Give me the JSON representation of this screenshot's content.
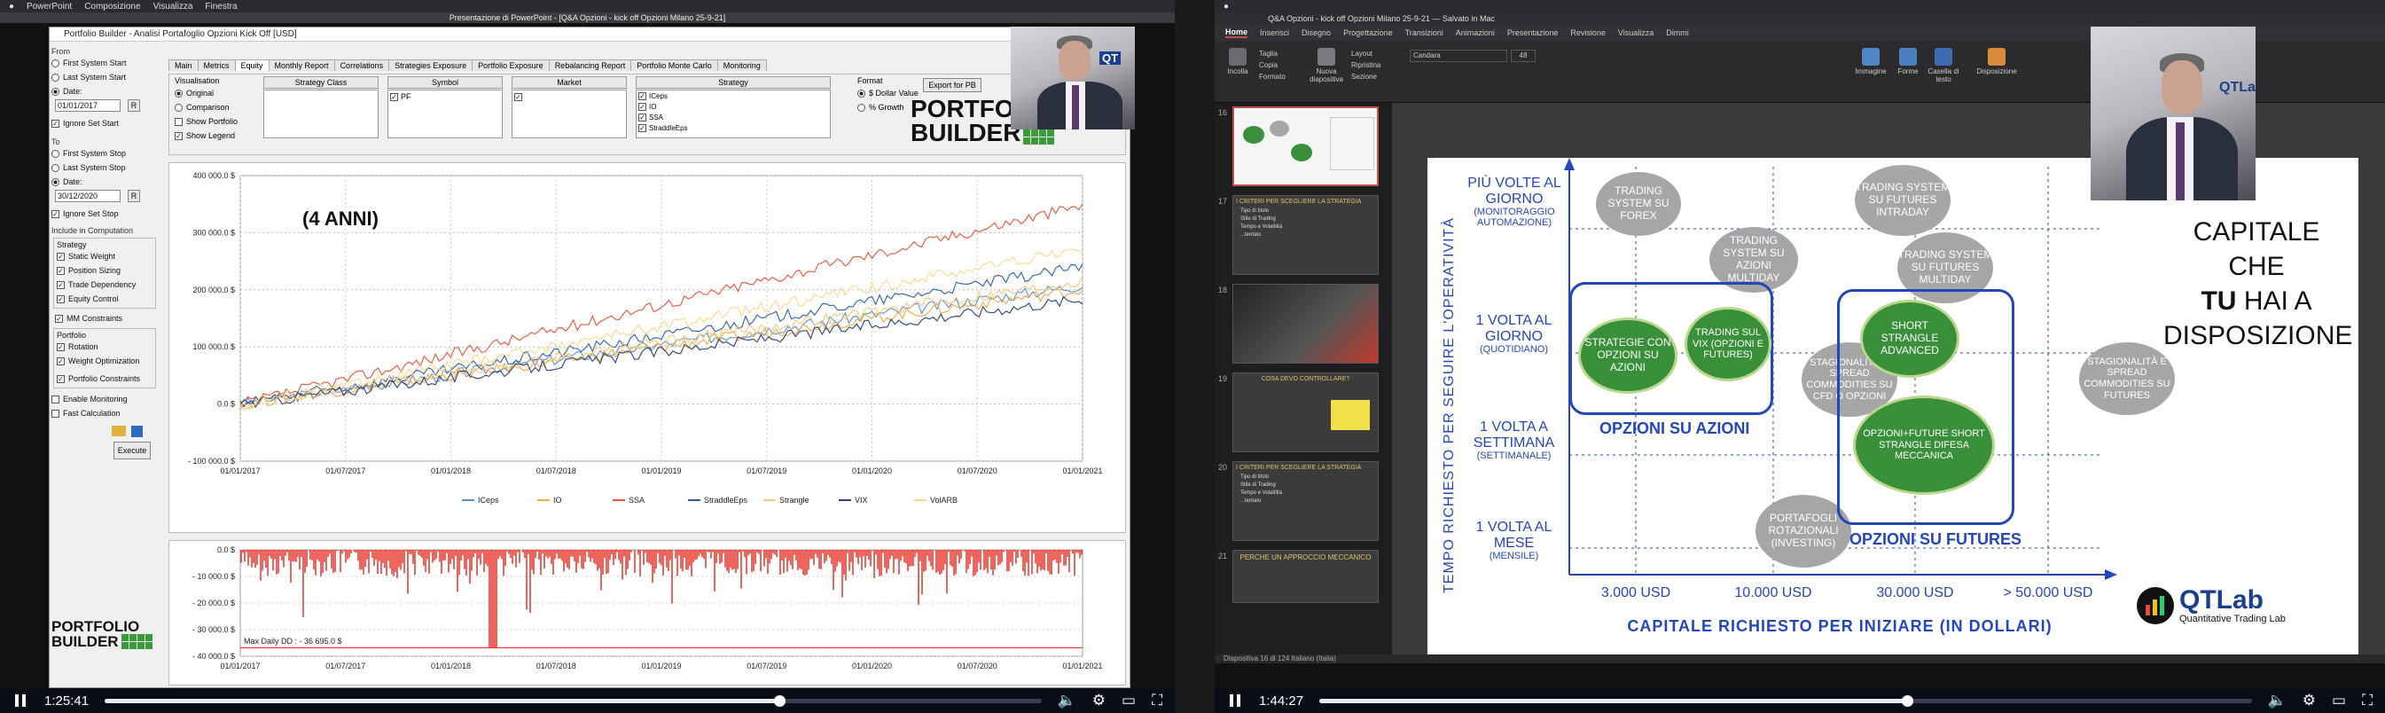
{
  "left": {
    "menubar": {
      "items": [
        "PowerPoint",
        "Composizione",
        "Visualizza",
        "Finestra"
      ]
    },
    "window_title": "Presentazione di PowerPoint - [Q&A Opzioni - kick off Opzioni Milano 25-9-21]",
    "app_title": "Portfolio Builder - Analisi Portafoglio Opzioni Kick Off [USD]",
    "sidebar": {
      "from_label": "From",
      "from_options": [
        "First System Start",
        "Last System Start",
        "Date:"
      ],
      "from_date": "01/01/2017",
      "r_label": "R",
      "ignore_start": "Ignore Set Start",
      "to_label": "To",
      "to_options": [
        "First System Stop",
        "Last System Stop",
        "Date:"
      ],
      "to_date": "30/12/2020",
      "ignore_stop": "Ignore Set Stop",
      "include_label": "Include in Computation",
      "strategy_label": "Strategy",
      "strategy_items": [
        "Static Weight",
        "Position Sizing",
        "Trade Dependency",
        "Equity Control"
      ],
      "mm_label": "MM Constraints",
      "portfolio_label": "Portfolio",
      "portfolio_items": [
        "Rotation",
        "Weight Optimization"
      ],
      "portfolio_constraints": "Portfolio Constraints",
      "enable_monitoring": "Enable Monitoring",
      "fast_calc": "Fast Calculation",
      "execute": "Execute"
    },
    "tabs": [
      "Main",
      "Metrics",
      "Equity",
      "Monthly Report",
      "Correlations",
      "Strategies Exposure",
      "Portfolio Exposure",
      "Rebalancing Report",
      "Portfolio Monte Carlo",
      "Monitoring"
    ],
    "visualisation": {
      "label": "Visualisation",
      "options": [
        "Original",
        "Comparison",
        "Show Portfolio",
        "Show Legend"
      ],
      "headers": [
        "Strategy Class",
        "Symbol",
        "Market",
        "Strategy"
      ],
      "symbol_item": "PF",
      "strategy_items": [
        "ICeps",
        "IO",
        "SSA",
        "StraddleEps"
      ]
    },
    "format": {
      "label": "Format",
      "options": [
        "$ Dollar Value",
        "% Growth"
      ],
      "export": "Export for PB"
    },
    "logo_line1": "PORTFOLIO",
    "logo_line2": "BUILDER",
    "equity_chart": {
      "annotation": "(4 ANNI)",
      "y_ticks": [
        "400 000.0 $",
        "300 000.0 $",
        "200 000.0 $",
        "100 000.0 $",
        "0.0 $",
        "- 100 000.0 $"
      ],
      "x_ticks": [
        "01/01/2017",
        "01/07/2017",
        "01/01/2018",
        "01/07/2018",
        "01/01/2019",
        "01/07/2019",
        "01/01/2020",
        "01/07/2020",
        "01/01/2021"
      ]
    },
    "dd_chart": {
      "y_ticks": [
        "0.0 $",
        "- 10 000.0 $",
        "- 20 000.0 $",
        "- 30 000.0 $",
        "- 40 000.0 $"
      ],
      "note": "Max Daily DD : - 36 695.0 $"
    },
    "player": {
      "time": "1:25:41",
      "progress": 0.72
    }
  },
  "right": {
    "window_title": "Q&A Opzioni - kick off Opzioni Milano 25-9-21 — Salvato in Mac",
    "tabs": [
      "Home",
      "Inserisci",
      "Disegno",
      "Progettazione",
      "Transizioni",
      "Animazioni",
      "Presentazione",
      "Revisione",
      "Visualizza",
      "Dimmi"
    ],
    "ribbon": {
      "buttons": [
        "Incolla",
        "Nuova diapositiva",
        "Immagine",
        "Forme",
        "Casella di testo",
        "Disposizione"
      ],
      "font_name": "Candara",
      "font_size": "48",
      "menu_items": [
        "Taglia",
        "Copia",
        "Formato",
        "Layout",
        "Ripristina",
        "Sezione"
      ]
    },
    "thumbs": [
      {
        "num": "16",
        "title": "",
        "lines": []
      },
      {
        "num": "17",
        "title": "I CRITERI PER SCEGLIERE LA STRATEGIA",
        "lines": [
          "Tipo di titolo",
          "Stile di Trading",
          "Tempo e Volatilità",
          "...tentato"
        ]
      },
      {
        "num": "18",
        "title": "",
        "lines": []
      },
      {
        "num": "19",
        "title": "COSA DEVO CONTROLLARE?",
        "lines": []
      },
      {
        "num": "20",
        "title": "I CRITERI PER SCEGLIERE LA STRATEGIA",
        "lines": [
          "Tipo di titolo",
          "Stile di Trading",
          "Tempo e Volatilità",
          "...tentato"
        ]
      },
      {
        "num": "21",
        "title": "PERCHE UN APPROCCIO MECCANICO",
        "lines": []
      }
    ],
    "slide": {
      "y_axis_title": "TEMPO RICHIESTO PER SEGUIRE L'OPERATIVITÀ",
      "x_axis_title": "CAPITALE RICHIESTO PER INIZIARE (IN DOLLARI)",
      "y_levels": [
        {
          "main": "PIÙ VOLTE AL GIORNO",
          "sub": "(MONITORAGGIO AUTOMAZIONE)"
        },
        {
          "main": "1 VOLTA AL GIORNO",
          "sub": "(QUOTIDIANO)"
        },
        {
          "main": "1 VOLTA A SETTIMANA",
          "sub": "(SETTIMANALE)"
        },
        {
          "main": "1 VOLTA AL MESE",
          "sub": "(MENSILE)"
        }
      ],
      "x_levels": [
        "3.000 USD",
        "10.000 USD",
        "30.000 USD",
        "> 50.000 USD"
      ],
      "bubbles_grey": [
        "TRADING SYSTEM SU FOREX",
        "TRADING SYSTEM SU AZIONI MULTIDAY",
        "TRADING SYSTEM SU FUTURES INTRADAY",
        "TRADING SYSTEM SU FUTURES MULTIDAY",
        "STAGIONALITÀ E SPREAD COMMODITIES SU CFD O OPZIONI",
        "STAGIONALITÀ E SPREAD COMMODITIES SU FUTURES",
        "PORTAFOGLI ROTAZIONALI (INVESTING)"
      ],
      "bubbles_green": [
        "STRATEGIE CON OPZIONI SU AZIONI",
        "TRADING SUL VIX (OPZIONI E FUTURES)",
        "SHORT STRANGLE ADVANCED",
        "OPZIONI+FUTURE SHORT STRANGLE DIFESA MECCANICA"
      ],
      "group_labels": [
        "OPZIONI SU AZIONI",
        "OPZIONI SU FUTURES"
      ],
      "side_text": [
        "CAPITALE CHE",
        "TU",
        "HAI A",
        "DISPOSIZIONE"
      ],
      "logo_text": "QTLab",
      "logo_sub": "Quantitative Trading Lab"
    },
    "status": "Diapositiva 16 di 124   Italiano (Italia)",
    "player": {
      "time": "1:44:27",
      "progress": 0.63
    }
  },
  "colors": {
    "green": "#3a8f3a",
    "blue": "#2446b8",
    "grey": "#a6a6a6",
    "dd": "#e8231a"
  }
}
